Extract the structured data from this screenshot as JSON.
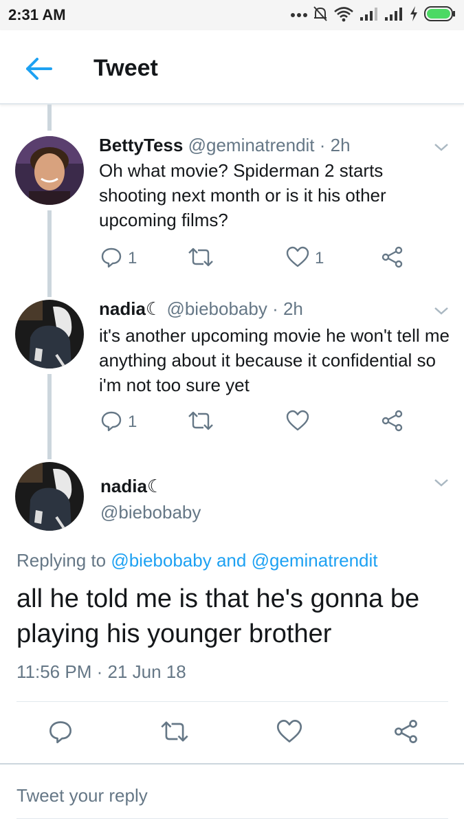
{
  "status_bar": {
    "time": "2:31 AM",
    "icons": [
      "more-dots-icon",
      "bell-muted-icon",
      "wifi-icon",
      "signal-icon",
      "signal-icon",
      "charging-icon",
      "battery-icon"
    ]
  },
  "header": {
    "title": "Tweet",
    "back_icon": "arrow-left-icon"
  },
  "replies": [
    {
      "name": "BettyTess",
      "handle": "@geminatrendit",
      "time": "· 2h",
      "text": "Oh what movie? Spiderman 2 starts shooting next month or is it his other upcoming films?",
      "reply_count": "1",
      "like_count": "1"
    },
    {
      "name": "nadia☾",
      "handle": "@biebobaby",
      "time": "· 2h",
      "text": "it's another upcoming movie he won't tell me anything about it because it confidential so i'm not too sure yet",
      "reply_count": "1",
      "like_count": ""
    }
  ],
  "main_tweet": {
    "name": "nadia☾",
    "handle": "@biebobaby",
    "replying_prefix": "Replying to",
    "replying_user1": "@biebobaby",
    "replying_and": "and",
    "replying_user2": "@geminatrendit",
    "text": "all he told me is that he's gonna be playing his younger brother",
    "timestamp": "11:56 PM · 21 Jun 18"
  },
  "reply_box": {
    "placeholder": "Tweet your reply"
  },
  "colors": {
    "accent": "#1da1f2",
    "secondary_text": "#657786",
    "icon_gray": "#657786",
    "thread_line": "#ccd6dd"
  }
}
